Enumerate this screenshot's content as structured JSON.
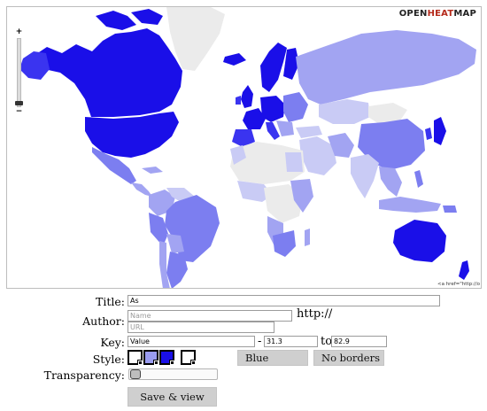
{
  "brand": {
    "open": "OPEN",
    "heat": "HEAT",
    "map": "MAP"
  },
  "map": {
    "credit": "<a href=\"http://o",
    "palette": {
      "dark": "#1a0fe8",
      "mid": "#3a34f0",
      "med": "#7c7ef0",
      "light": "#a2a4f2",
      "pale": "#c9cbf5",
      "none": "#ebebeb"
    }
  },
  "form": {
    "title_label": "Title:",
    "title_value": "As",
    "author_label": "Author:",
    "name_placeholder": "Name",
    "url_placeholder": "URL",
    "http_text": "http://",
    "key_label": "Key:",
    "key_value": "Value",
    "dash": "-",
    "range_min": "31.3",
    "to_text": "to",
    "range_max": "82.9",
    "style_label": "Style:",
    "style_swatches": [
      "#ffffff",
      "#9a9cf0",
      "#1a0fe8"
    ],
    "color_button": "Blue",
    "borders_button": "No borders",
    "transparency_label": "Transparency:",
    "transparency_level": 0,
    "save_button": "Save & view"
  }
}
